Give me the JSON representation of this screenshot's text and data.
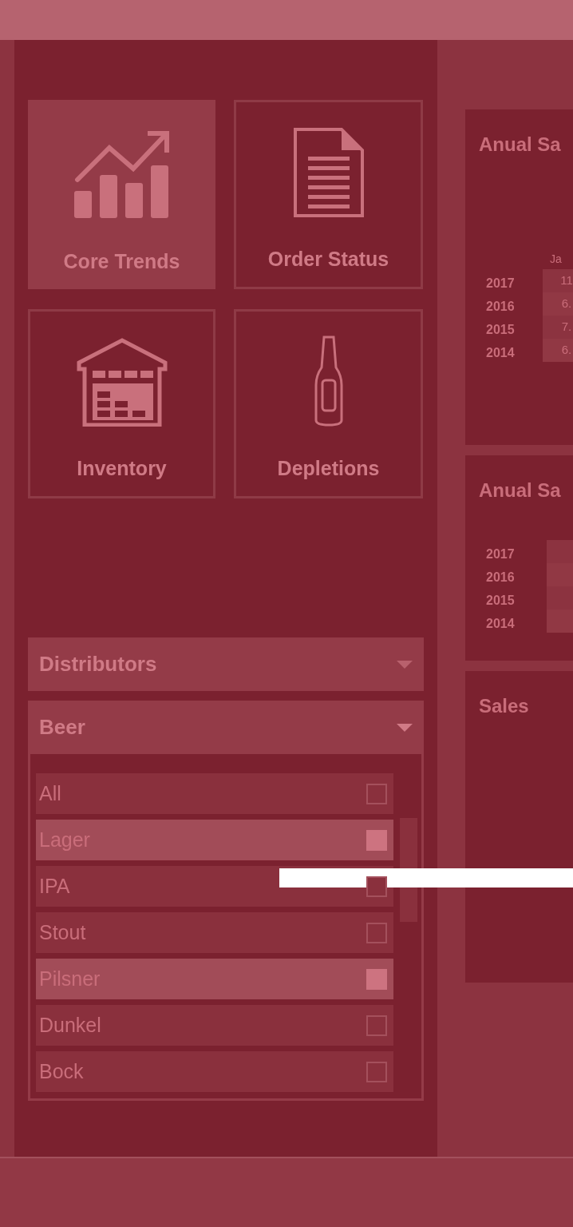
{
  "tiles": [
    {
      "label": "Core Trends",
      "selected": true
    },
    {
      "label": "Order Status",
      "selected": false
    },
    {
      "label": "Inventory",
      "selected": false
    },
    {
      "label": "Depletions",
      "selected": false
    }
  ],
  "filters": [
    {
      "label": "Distributors",
      "expanded": false
    },
    {
      "label": "Beer",
      "expanded": true
    }
  ],
  "beer_list": [
    {
      "label": "All",
      "checked": false
    },
    {
      "label": "Lager",
      "checked": true
    },
    {
      "label": "IPA",
      "checked": false
    },
    {
      "label": "Stout",
      "checked": false
    },
    {
      "label": "Pilsner",
      "checked": true
    },
    {
      "label": "Dunkel",
      "checked": false
    },
    {
      "label": "Bock",
      "checked": false
    }
  ],
  "cards": [
    {
      "kind": "table",
      "title": "Anual Sa",
      "column": "Ja",
      "rows": [
        {
          "year": "2017",
          "value": "11"
        },
        {
          "year": "2016",
          "value": "6."
        },
        {
          "year": "2015",
          "value": "7."
        },
        {
          "year": "2014",
          "value": "6."
        }
      ]
    },
    {
      "kind": "table",
      "title": "Anual Sa",
      "rows": [
        {
          "year": "2017"
        },
        {
          "year": "2016"
        },
        {
          "year": "2015"
        },
        {
          "year": "2014"
        }
      ]
    },
    {
      "kind": "chart",
      "title": "Sales"
    }
  ]
}
